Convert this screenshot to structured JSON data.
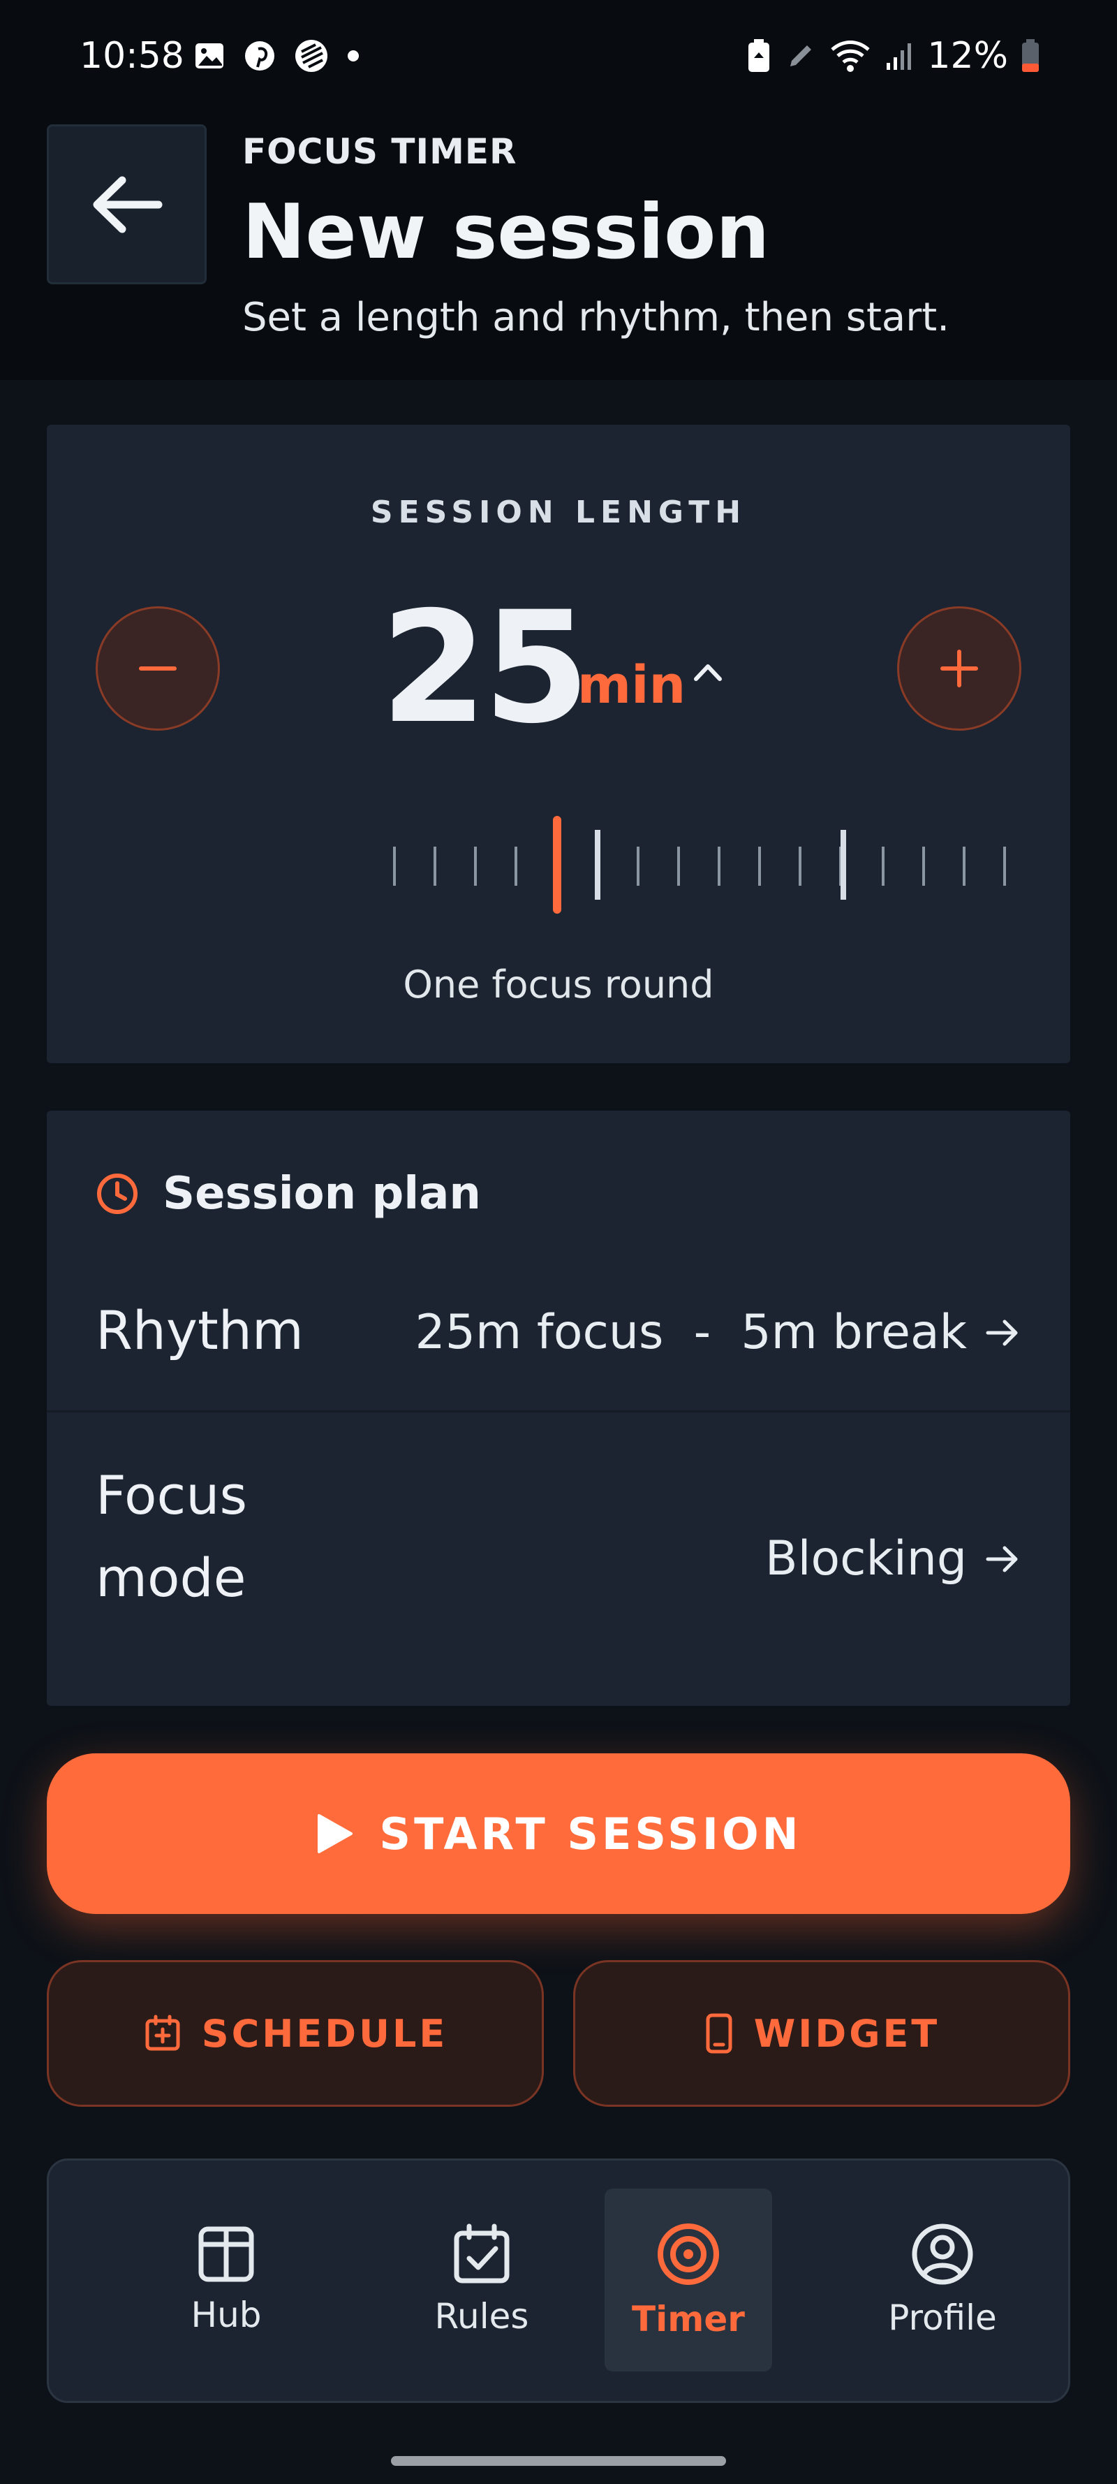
{
  "status_bar": {
    "time": "10:58",
    "battery": "12%"
  },
  "header": {
    "eyebrow": "FOCUS TIMER",
    "title": "New session",
    "subtitle": "Set a length and rhythm, then start."
  },
  "session_length": {
    "label": "SESSION LENGTH",
    "value": "25",
    "unit": "min",
    "caption": "One focus round"
  },
  "session_plan": {
    "title": "Session plan",
    "rows": [
      {
        "label": "Rhythm",
        "value": "25m focus  -  5m break"
      },
      {
        "label": "Focus\nmode",
        "value": "Blocking"
      }
    ]
  },
  "actions": {
    "start": "START SESSION",
    "schedule": "SCHEDULE",
    "widget": "WIDGET"
  },
  "nav": {
    "items": [
      {
        "label": "Hub",
        "icon": "hub-icon"
      },
      {
        "label": "Rules",
        "icon": "rules-icon"
      },
      {
        "label": "Timer",
        "icon": "timer-icon",
        "active": true
      },
      {
        "label": "Profile",
        "icon": "profile-icon"
      }
    ]
  },
  "colors": {
    "accent": "#ff6b3b",
    "background": "#0d1218",
    "card": "#1b2430"
  }
}
